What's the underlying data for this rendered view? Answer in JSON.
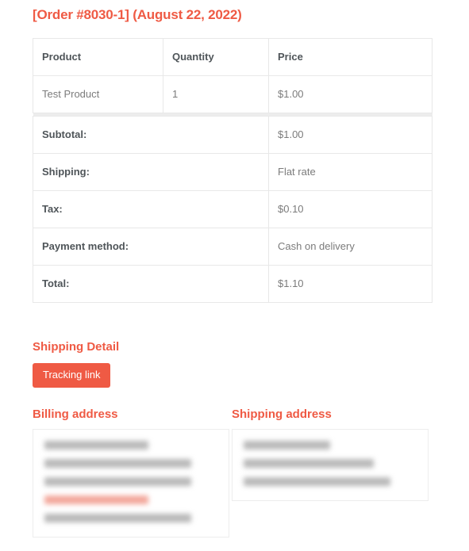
{
  "order": {
    "title": "[Order #8030-1] (August 22, 2022)",
    "number": "8030-1",
    "date": "August 22, 2022"
  },
  "table": {
    "headers": {
      "product": "Product",
      "quantity": "Quantity",
      "price": "Price"
    },
    "items": [
      {
        "product": "Test Product",
        "quantity": "1",
        "price": "$1.00"
      }
    ],
    "summary": [
      {
        "label": "Subtotal:",
        "value": "$1.00"
      },
      {
        "label": "Shipping:",
        "value": "Flat rate"
      },
      {
        "label": "Tax:",
        "value": "$0.10"
      },
      {
        "label": "Payment method:",
        "value": "Cash on delivery"
      },
      {
        "label": "Total:",
        "value": "$1.10"
      }
    ]
  },
  "shipping_detail": {
    "heading": "Shipping Detail",
    "tracking_button_label": "Tracking link"
  },
  "addresses": {
    "billing": {
      "heading": "Billing address",
      "redacted_lines": 5
    },
    "shipping": {
      "heading": "Shipping address",
      "redacted_lines": 3
    }
  },
  "colors": {
    "accent": "#ef5a44",
    "heading_text": "#4f5559",
    "body_text": "#7b7b7b",
    "border": "#e8e8e8"
  }
}
